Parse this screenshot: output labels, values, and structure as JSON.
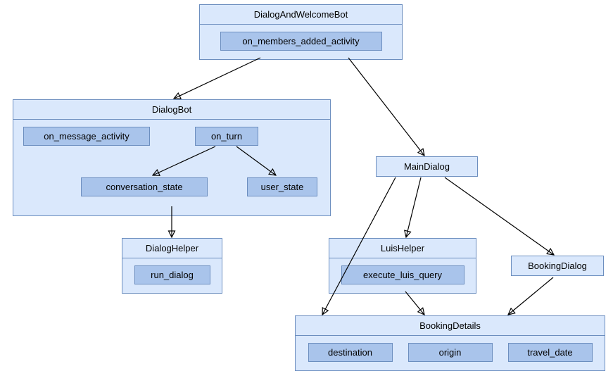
{
  "nodes": {
    "dialogAndWelcomeBot": {
      "title": "DialogAndWelcomeBot",
      "members": {
        "on_members_added_activity": "on_members_added_activity"
      }
    },
    "dialogBot": {
      "title": "DialogBot",
      "members": {
        "on_message_activity": "on_message_activity",
        "on_turn": "on_turn",
        "conversation_state": "conversation_state",
        "user_state": "user_state"
      }
    },
    "dialogHelper": {
      "title": "DialogHelper",
      "members": {
        "run_dialog": "run_dialog"
      }
    },
    "mainDialog": {
      "title": "MainDialog"
    },
    "luisHelper": {
      "title": "LuisHelper",
      "members": {
        "execute_luis_query": "execute_luis_query"
      }
    },
    "bookingDialog": {
      "title": "BookingDialog"
    },
    "bookingDetails": {
      "title": "BookingDetails",
      "members": {
        "destination": "destination",
        "origin": "origin",
        "travel_date": "travel_date"
      }
    }
  },
  "edges": [
    {
      "from": "dialogAndWelcomeBot",
      "to": "dialogBot"
    },
    {
      "from": "dialogAndWelcomeBot",
      "to": "mainDialog"
    },
    {
      "from": "dialogBot.on_turn",
      "to": "dialogBot.conversation_state"
    },
    {
      "from": "dialogBot.on_turn",
      "to": "dialogBot.user_state"
    },
    {
      "from": "dialogBot",
      "to": "dialogHelper"
    },
    {
      "from": "mainDialog",
      "to": "luisHelper"
    },
    {
      "from": "mainDialog",
      "to": "bookingDialog"
    },
    {
      "from": "mainDialog",
      "to": "bookingDetails"
    },
    {
      "from": "luisHelper",
      "to": "bookingDetails"
    },
    {
      "from": "bookingDialog",
      "to": "bookingDetails"
    }
  ]
}
